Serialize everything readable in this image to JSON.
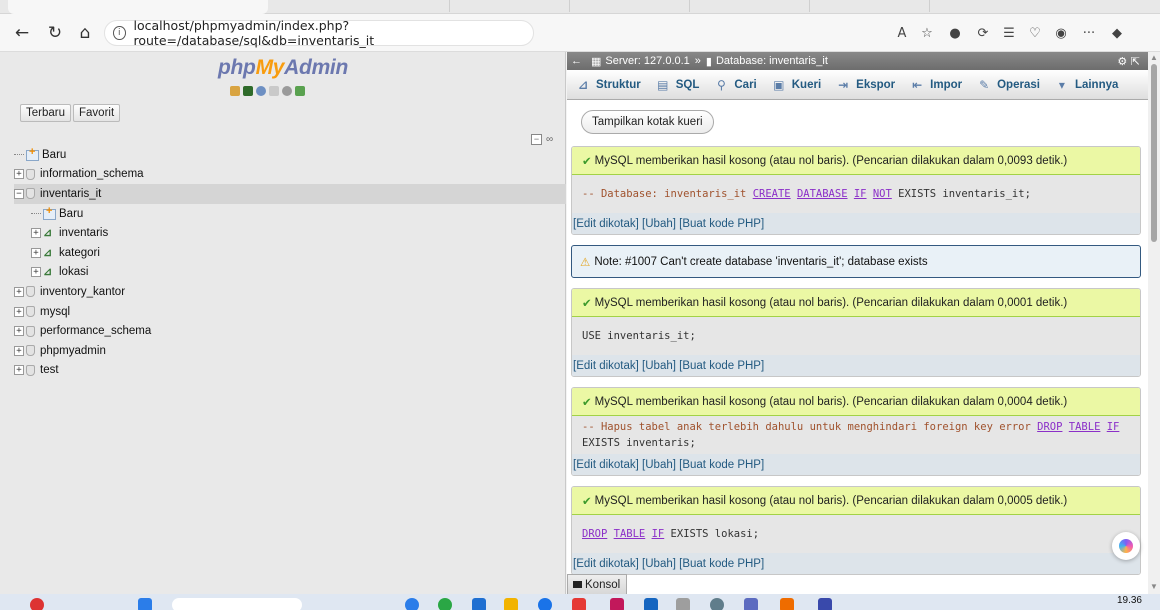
{
  "browser": {
    "url": "localhost/phpmyadmin/index.php?route=/database/sql&db=inventaris_it",
    "ellipsis": "···"
  },
  "nav": {
    "logo_php": "php",
    "logo_my": "My",
    "logo_admin": "Admin",
    "recent_label": "Terbaru",
    "favorite_label": "Favorit",
    "tree": [
      {
        "label": "Baru",
        "kind": "new",
        "depth": 0
      },
      {
        "label": "information_schema",
        "kind": "db",
        "depth": 0
      },
      {
        "label": "inventaris_it",
        "kind": "db",
        "depth": 0,
        "expanded": true,
        "selected": true
      },
      {
        "label": "Baru",
        "kind": "new",
        "depth": 1
      },
      {
        "label": "inventaris",
        "kind": "table",
        "depth": 1
      },
      {
        "label": "kategori",
        "kind": "table",
        "depth": 1
      },
      {
        "label": "lokasi",
        "kind": "table",
        "depth": 1
      },
      {
        "label": "inventory_kantor",
        "kind": "db",
        "depth": 0
      },
      {
        "label": "mysql",
        "kind": "db",
        "depth": 0
      },
      {
        "label": "performance_schema",
        "kind": "db",
        "depth": 0
      },
      {
        "label": "phpmyadmin",
        "kind": "db",
        "depth": 0
      },
      {
        "label": "test",
        "kind": "db",
        "depth": 0
      }
    ]
  },
  "breadcrumb": {
    "server": "Server: 127.0.0.1",
    "separator": "»",
    "database": "Database: inventaris_it"
  },
  "menu": {
    "tabs": [
      {
        "label": "Struktur",
        "icon": "structure-icon"
      },
      {
        "label": "SQL",
        "icon": "sql-icon"
      },
      {
        "label": "Cari",
        "icon": "search-icon"
      },
      {
        "label": "Kueri",
        "icon": "query-icon"
      },
      {
        "label": "Ekspor",
        "icon": "export-icon"
      },
      {
        "label": "Impor",
        "icon": "import-icon"
      },
      {
        "label": "Operasi",
        "icon": "wrench-icon"
      },
      {
        "label": "Lainnya",
        "icon": "chevron-down-icon"
      }
    ]
  },
  "content": {
    "show_query_box": "Tampilkan kotak kueri",
    "links": {
      "edit_inline": "Edit dikotak",
      "edit": "Ubah",
      "php_code": "Buat kode PHP"
    },
    "note": "Note: #1007 Can't create database 'inventaris_it'; database exists",
    "results": [
      {
        "message": "MySQL memberikan hasil kosong (atau nol baris). (Pencarian dilakukan dalam 0,0093 detik.)",
        "sql": [
          {
            "t": "-- Database: inventaris_it ",
            "c": "cmt"
          },
          {
            "t": "CREATE",
            "c": "kw"
          },
          {
            "t": " ",
            "c": "plain"
          },
          {
            "t": "DATABASE",
            "c": "kw"
          },
          {
            "t": " ",
            "c": "plain"
          },
          {
            "t": "IF",
            "c": "kw"
          },
          {
            "t": " ",
            "c": "plain"
          },
          {
            "t": "NOT",
            "c": "kw"
          },
          {
            "t": " ",
            "c": "plain"
          },
          {
            "t": "EXISTS",
            "c": "plain"
          },
          {
            "t": " inventaris_it;",
            "c": "plain"
          }
        ]
      },
      {
        "message": "MySQL memberikan hasil kosong (atau nol baris). (Pencarian dilakukan dalam 0,0001 detik.)",
        "sql": [
          {
            "t": "USE inventaris_it;",
            "c": "plain"
          }
        ]
      },
      {
        "message": "MySQL memberikan hasil kosong (atau nol baris). (Pencarian dilakukan dalam 0,0004 detik.)",
        "sql": [
          {
            "t": "-- Hapus tabel anak terlebih dahulu untuk menghindari foreign key error ",
            "c": "cmt"
          },
          {
            "t": "DROP",
            "c": "kw"
          },
          {
            "t": " ",
            "c": "plain"
          },
          {
            "t": "TABLE",
            "c": "kw"
          },
          {
            "t": " ",
            "c": "plain"
          },
          {
            "t": "IF",
            "c": "kw"
          },
          {
            "t": " ",
            "c": "plain"
          },
          {
            "t": "EXISTS",
            "c": "plain"
          },
          {
            "t": " inventaris;",
            "c": "plain"
          }
        ]
      },
      {
        "message": "MySQL memberikan hasil kosong (atau nol baris). (Pencarian dilakukan dalam 0,0005 detik.)",
        "sql": [
          {
            "t": "DROP",
            "c": "kw"
          },
          {
            "t": " ",
            "c": "plain"
          },
          {
            "t": "TABLE",
            "c": "kw"
          },
          {
            "t": " ",
            "c": "plain"
          },
          {
            "t": "IF",
            "c": "kw"
          },
          {
            "t": " ",
            "c": "plain"
          },
          {
            "t": "EXISTS",
            "c": "plain"
          },
          {
            "t": " lokasi;",
            "c": "plain"
          }
        ]
      }
    ]
  },
  "console_label": "Konsol",
  "taskbar": {
    "clock": "19.36"
  },
  "colors": {
    "success_bg": "#ebf8a4",
    "note_bg": "#e9f1f7",
    "link": "#235a81",
    "keyword": "#8b2fc8",
    "comment": "#a0522d"
  }
}
